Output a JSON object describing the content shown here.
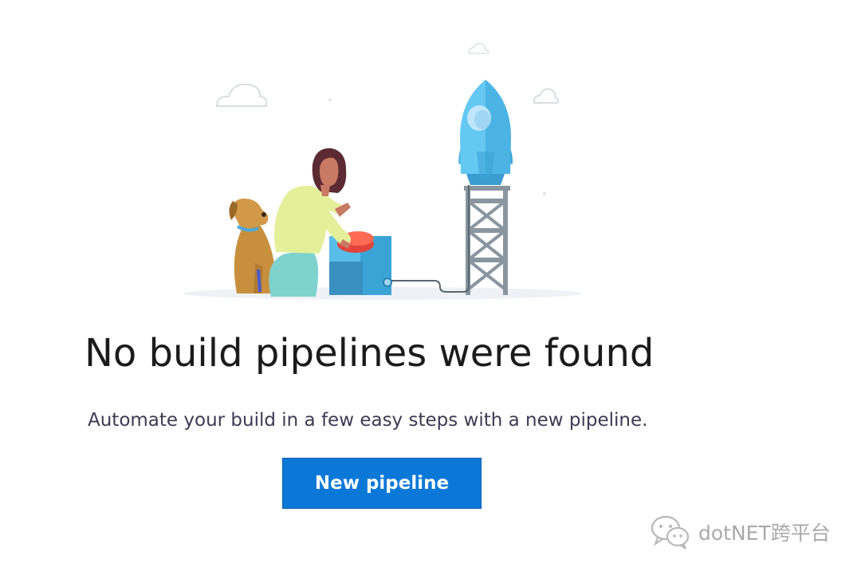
{
  "empty_state": {
    "title": "No build pipelines were found",
    "description": "Automate your build in a few easy steps with a new pipeline.",
    "primary_action_label": "New pipeline",
    "illustration": "rocket-launch-illustration"
  },
  "watermark": {
    "text": "dotNET跨平台",
    "icon": "wechat-icon"
  },
  "colors": {
    "button_bg": "#0b78d8",
    "title_text": "#1b1b1b",
    "description_text": "#3d3a52",
    "rocket_blue": "#5fc6f0"
  }
}
